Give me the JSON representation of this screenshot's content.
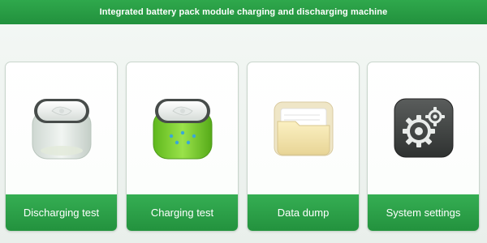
{
  "header": {
    "title": "Integrated battery pack module charging and discharging machine"
  },
  "menu": {
    "items": [
      {
        "label": "Discharging test",
        "icon": "battery-empty-icon"
      },
      {
        "label": "Charging test",
        "icon": "battery-charging-icon"
      },
      {
        "label": "Data dump",
        "icon": "folder-icon"
      },
      {
        "label": "System settings",
        "icon": "gear-icon"
      }
    ]
  },
  "colors": {
    "accent": "#2a9d47",
    "card_border": "#c9d6cc",
    "battery_fill": "#7fd12a"
  }
}
